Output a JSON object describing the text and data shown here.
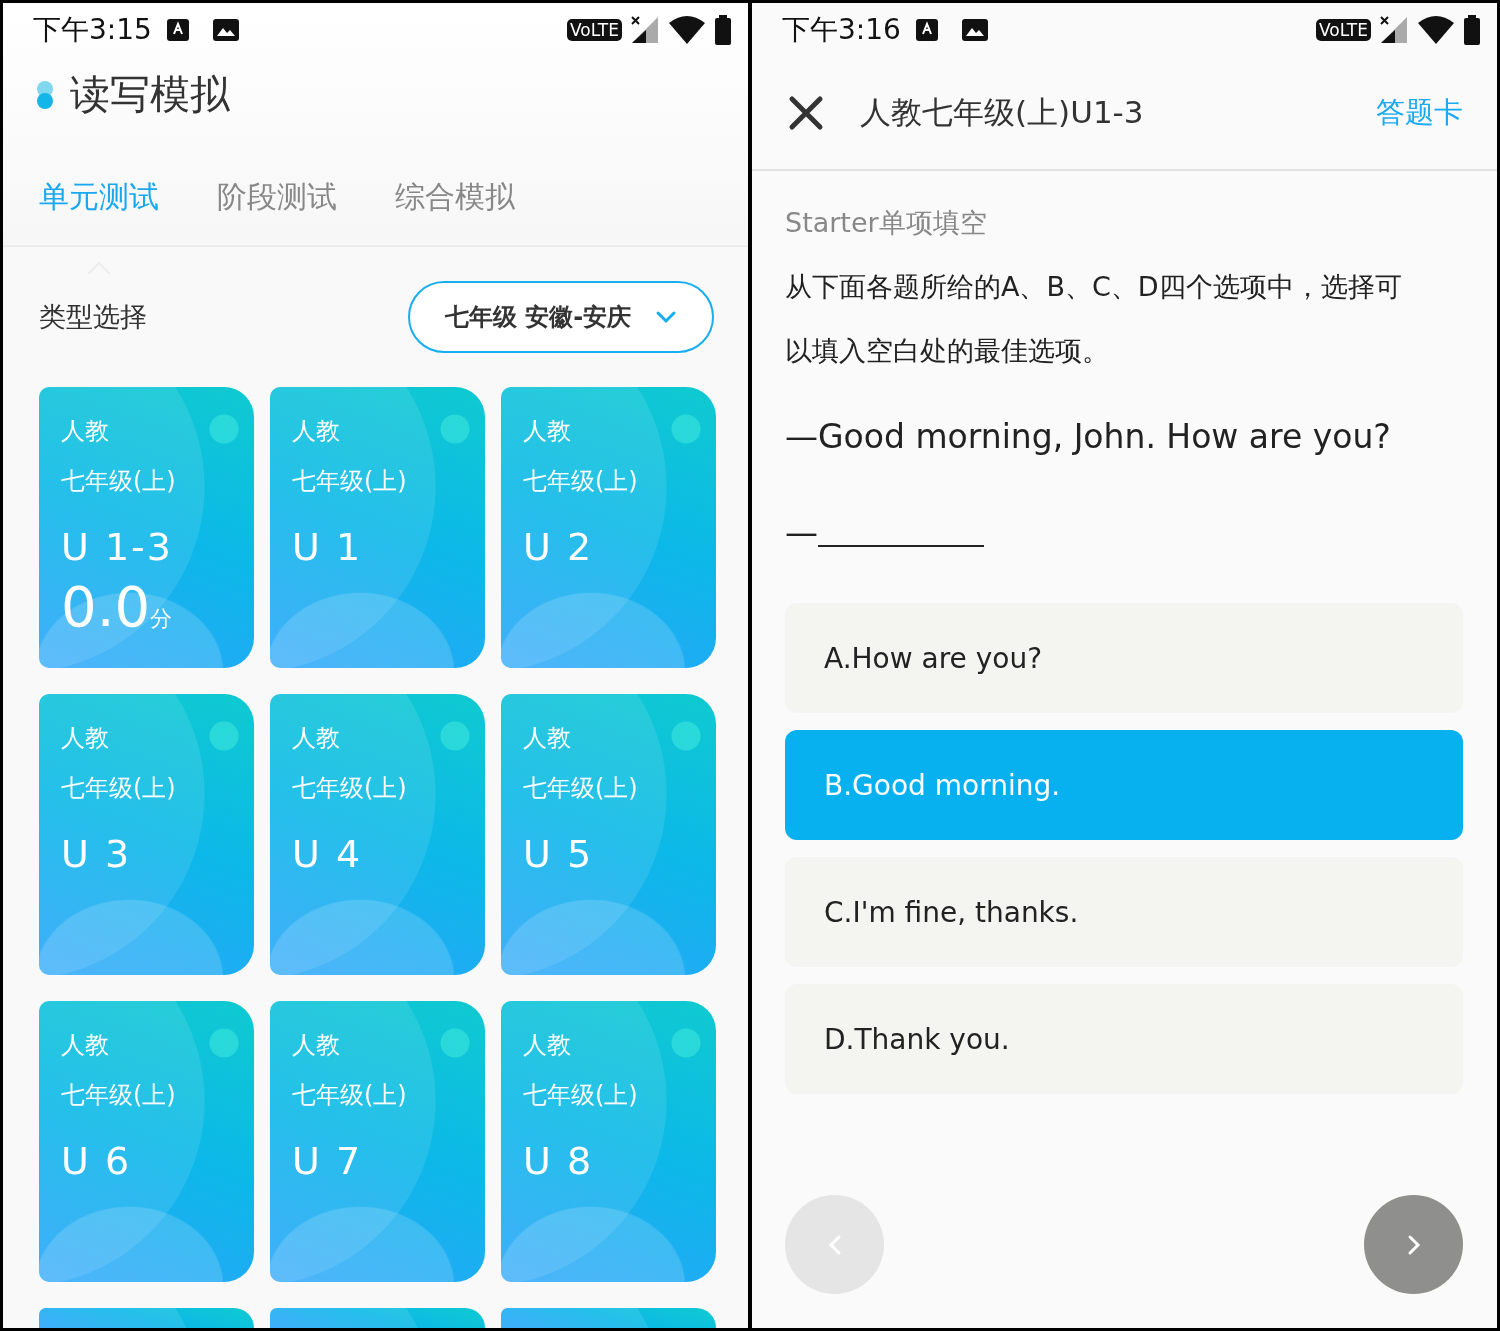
{
  "left": {
    "status_bar": {
      "time": "下午3:15",
      "network_label": "VoLTE"
    },
    "title": "读写模拟",
    "tabs": [
      {
        "label": "单元测试",
        "selected": true
      },
      {
        "label": "阶段测试",
        "selected": false
      },
      {
        "label": "综合模拟",
        "selected": false
      }
    ],
    "filter": {
      "label": "类型选择",
      "value": "七年级 安徽-安庆"
    },
    "cards": [
      {
        "kind": "unit",
        "publisher": "人教",
        "grade": "七年级(上)",
        "unit": "U 1-3",
        "score": "0.0",
        "score_unit": "分"
      },
      {
        "kind": "unit",
        "publisher": "人教",
        "grade": "七年级(上)",
        "unit": "U 1"
      },
      {
        "kind": "unit",
        "publisher": "人教",
        "grade": "七年级(上)",
        "unit": "U 2"
      },
      {
        "kind": "unit",
        "publisher": "人教",
        "grade": "七年级(上)",
        "unit": "U 3"
      },
      {
        "kind": "unit",
        "publisher": "人教",
        "grade": "七年级(上)",
        "unit": "U 4"
      },
      {
        "kind": "unit",
        "publisher": "人教",
        "grade": "七年级(上)",
        "unit": "U 5"
      },
      {
        "kind": "unit",
        "publisher": "人教",
        "grade": "七年级(上)",
        "unit": "U 6"
      },
      {
        "kind": "unit",
        "publisher": "人教",
        "grade": "七年级(上)",
        "unit": "U 7"
      },
      {
        "kind": "unit",
        "publisher": "人教",
        "grade": "七年级(上)",
        "unit": "U 8"
      },
      {
        "kind": "cut"
      },
      {
        "kind": "cut"
      },
      {
        "kind": "cut"
      }
    ]
  },
  "right": {
    "status_bar": {
      "time": "下午3:16",
      "network_label": "VoLTE"
    },
    "title": "人教七年级(上)U1-3",
    "answer_card_link": "答题卡",
    "section": "Starter单项填空",
    "instructions": "从下面各题所给的A、B、C、D四个选项中，选择可以填入空白处的最佳选项。",
    "question": {
      "prompt": "—Good morning, John. How are you?",
      "blank_prefix": "—"
    },
    "options": [
      {
        "text": "A.How are you?",
        "selected": false
      },
      {
        "text": "B.Good morning.",
        "selected": true
      },
      {
        "text": "C.I'm fine, thanks.",
        "selected": false
      },
      {
        "text": "D.Thank you.",
        "selected": false
      }
    ],
    "nav": {
      "prev": {
        "disabled": true
      },
      "next": {
        "disabled": false
      }
    }
  }
}
